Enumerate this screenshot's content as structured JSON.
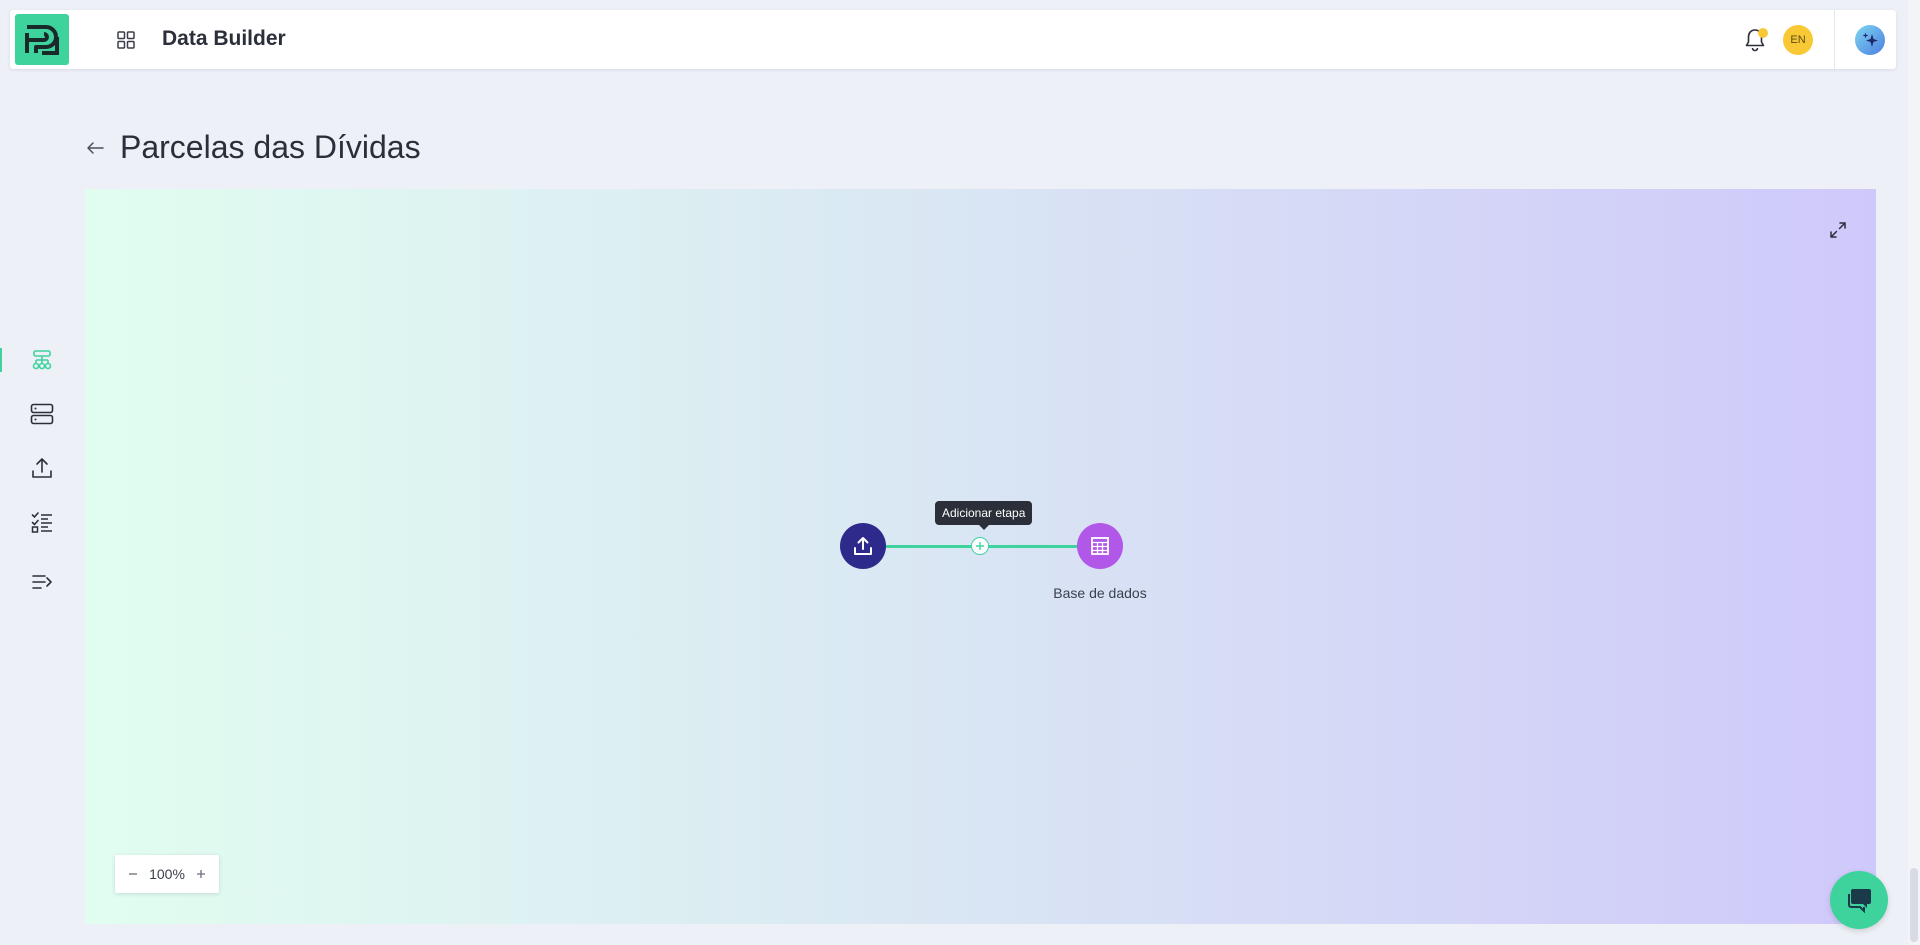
{
  "app": {
    "title": "Data Builder",
    "language_badge": "EN",
    "accent_color": "#3ed39c",
    "notification_dot_color": "#f9c935"
  },
  "sidebar": {
    "items": [
      {
        "icon": "pipeline-icon",
        "active": true
      },
      {
        "icon": "database-icon",
        "active": false
      },
      {
        "icon": "upload-icon",
        "active": false
      },
      {
        "icon": "checklist-icon",
        "active": false
      },
      {
        "icon": "expand-sidebar-icon",
        "active": false
      }
    ]
  },
  "page": {
    "title": "Parcelas das Dívidas"
  },
  "flow": {
    "nodes": [
      {
        "icon": "upload-icon",
        "color": "#2e2a8c",
        "label": ""
      },
      {
        "icon": "table-icon",
        "color": "#b258e8",
        "label": "Base de dados"
      }
    ],
    "add_step_tooltip": "Adicionar etapa"
  },
  "zoom": {
    "value": "100%"
  }
}
